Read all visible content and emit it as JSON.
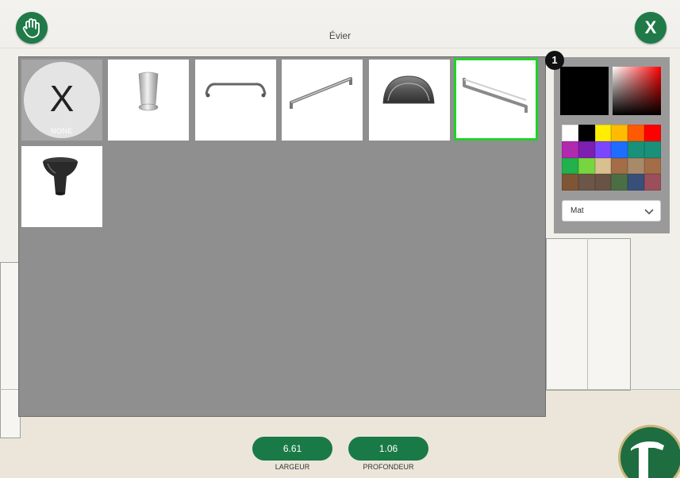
{
  "header": {
    "title": "Évier",
    "close_label": "X"
  },
  "grid": {
    "items": [
      {
        "name": "none",
        "label": "NONE",
        "glyph": "X"
      },
      {
        "name": "round-knob"
      },
      {
        "name": "arched-pull"
      },
      {
        "name": "bar-pull-square"
      },
      {
        "name": "cup-pull"
      },
      {
        "name": "bar-pull-flat",
        "selected": true
      },
      {
        "name": "black-knob"
      }
    ]
  },
  "color_panel": {
    "badge": "1",
    "current_color": "#000000",
    "palette": [
      "#ffffff",
      "#000000",
      "#ffee00",
      "#ffbb00",
      "#ff5a00",
      "#ff0000",
      "#b02ab0",
      "#7d1fb0",
      "#7b46ff",
      "#1f6dff",
      "#19917a",
      "#19917a",
      "#22b14c",
      "#77d63f",
      "#d9c091",
      "#a36d47",
      "#a78a6a",
      "#a36d47",
      "#7f5535",
      "#6b5648",
      "#6a5344",
      "#4b6e44",
      "#384f7a",
      "#9a4f5a"
    ],
    "finish": "Mat"
  },
  "dimensions": {
    "width_value": "6.61",
    "width_label": "LARGEUR",
    "depth_value": "1.06",
    "depth_label": "PROFONDEUR"
  },
  "colors": {
    "accent_green": "#1f7a48",
    "selected_border": "#22d12a",
    "panel_gray": "#8f8f8f"
  }
}
